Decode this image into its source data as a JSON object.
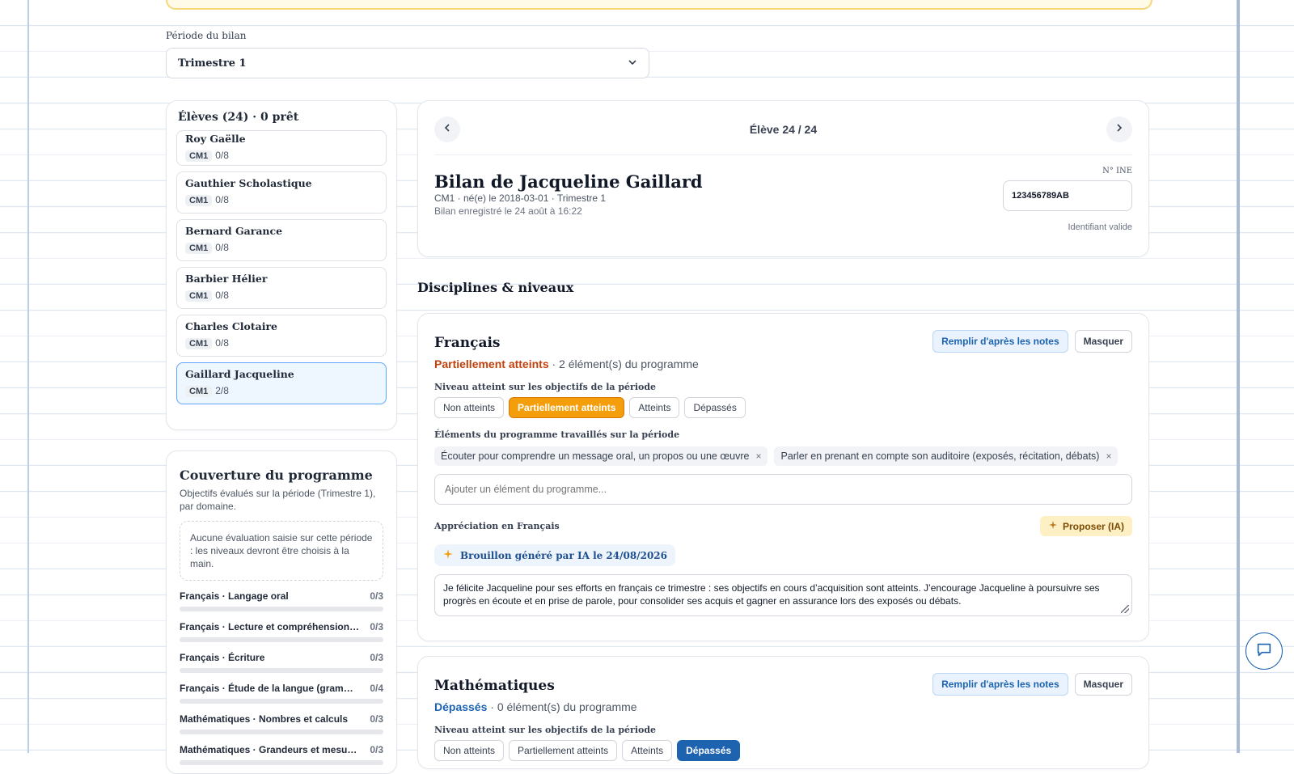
{
  "period": {
    "label": "Période du bilan",
    "selected": "Trimestre 1"
  },
  "students": {
    "title": "Élèves (24) · 0 prêt",
    "items": [
      {
        "name": "Roy Gaëlle",
        "level": "CM1",
        "count": "0/8"
      },
      {
        "name": "Gauthier Scholastique",
        "level": "CM1",
        "count": "0/8"
      },
      {
        "name": "Bernard Garance",
        "level": "CM1",
        "count": "0/8"
      },
      {
        "name": "Barbier Hélier",
        "level": "CM1",
        "count": "0/8"
      },
      {
        "name": "Charles Clotaire",
        "level": "CM1",
        "count": "0/8"
      },
      {
        "name": "Gaillard Jacqueline",
        "level": "CM1",
        "count": "2/8"
      }
    ]
  },
  "coverage": {
    "title": "Couverture du programme",
    "subtitle": "Objectifs évalués sur la période (Trimestre 1), par domaine.",
    "empty": "Aucune évaluation saisie sur cette période : les niveaux devront être choisis à la main.",
    "items": [
      {
        "label": "Français · Langage oral",
        "value": "0/3"
      },
      {
        "label": "Français · Lecture et compréhension de l'écrit",
        "value": "0/3"
      },
      {
        "label": "Français · Écriture",
        "value": "0/3"
      },
      {
        "label": "Français · Étude de la langue (grammaire)",
        "value": "0/4"
      },
      {
        "label": "Mathématiques · Nombres et calculs",
        "value": "0/3"
      },
      {
        "label": "Mathématiques · Grandeurs et mesures",
        "value": "0/3"
      }
    ]
  },
  "student_card": {
    "nav": "Élève 24 / 24",
    "title": "Bilan de Jacqueline Gaillard",
    "meta": "CM1 · né(e) le 2018-03-01 · Trimestre 1",
    "saved": "Bilan enregistré le 24 août à 16:22",
    "ine_label": "N° INE",
    "ine_value": "123456789AB",
    "ine_status": "Identifiant valide"
  },
  "disciplines_title": "Disciplines & niveaux",
  "francais": {
    "name": "Français",
    "status": "Partiellement atteints",
    "elements": "· 2 élément(s) du programme",
    "fill_btn": "Remplir d'après les notes",
    "hide_btn": "Masquer",
    "level_label": "Niveau atteint sur les objectifs de la période",
    "levels": [
      "Non atteints",
      "Partiellement atteints",
      "Atteints",
      "Dépassés"
    ],
    "elements_label": "Éléments du programme travaillés sur la période",
    "chips": [
      "Écouter pour comprendre un message oral, un propos ou une œuvre",
      "Parler en prenant en compte son auditoire (exposés, récitation, débats)"
    ],
    "chip_remove": "×",
    "add_placeholder": "Ajouter un élément du programme...",
    "appr_label": "Appréciation en Français",
    "ia_btn": "Proposer (IA)",
    "draft": "Brouillon généré par IA le 24/08/2026",
    "text": "Je félicite Jacqueline pour ses efforts en français ce trimestre : ses objectifs en cours d’acquisition sont atteints. J’encourage Jacqueline à poursuivre ses progrès en écoute et en prise de parole, pour consolider ses acquis et gagner en assurance lors des exposés ou débats."
  },
  "maths": {
    "name": "Mathématiques",
    "status": "Dépassés",
    "elements": "· 0 élément(s) du programme",
    "fill_btn": "Remplir d'après les notes",
    "hide_btn": "Masquer",
    "level_label": "Niveau atteint sur les objectifs de la période",
    "levels": [
      "Non atteints",
      "Partiellement atteints",
      "Atteints",
      "Dépassés"
    ]
  },
  "colors": {
    "accent": "#1d63b0",
    "partial": "#f59e0b",
    "highlight": "#60a5fa"
  }
}
